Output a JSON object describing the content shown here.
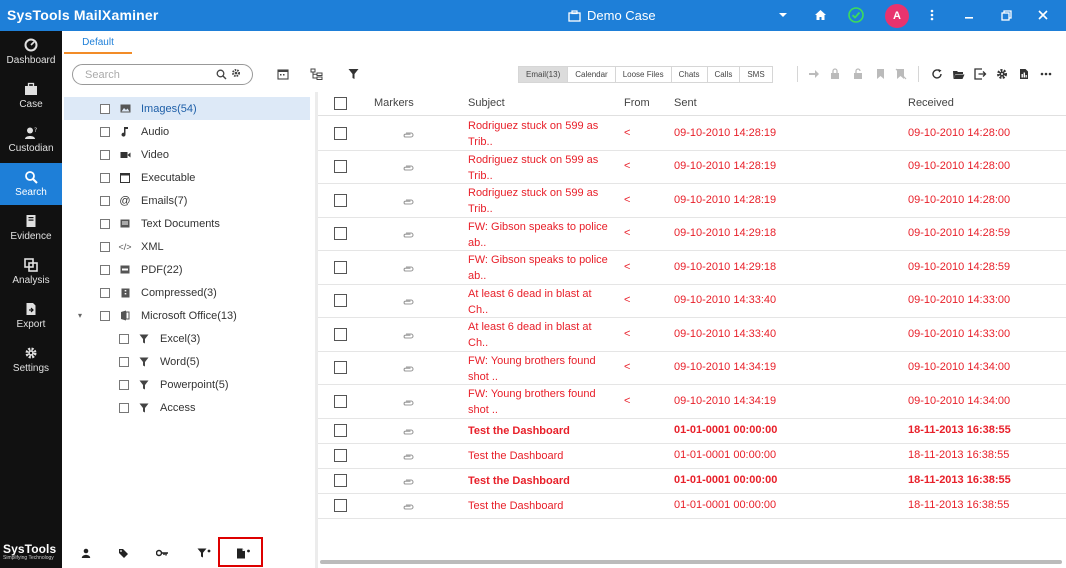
{
  "app": {
    "title": "SysTools MailXaminer",
    "case_title": "Demo Case",
    "avatar_initial": "A"
  },
  "nav": [
    {
      "label": "Dashboard",
      "icon": "dashboard-icon"
    },
    {
      "label": "Case",
      "icon": "briefcase-icon"
    },
    {
      "label": "Custodian",
      "icon": "custodian-icon"
    },
    {
      "label": "Search",
      "icon": "search-icon",
      "active": true
    },
    {
      "label": "Evidence",
      "icon": "evidence-icon"
    },
    {
      "label": "Analysis",
      "icon": "analysis-icon"
    },
    {
      "label": "Export",
      "icon": "export-icon"
    },
    {
      "label": "Settings",
      "icon": "gear-icon"
    }
  ],
  "brand": {
    "name": "SysTools",
    "tagline": "Simplifying Technology"
  },
  "tabs": {
    "default_label": "Default"
  },
  "search": {
    "placeholder": "Search",
    "value": ""
  },
  "category_tabs": [
    "Email(13)",
    "Calendar",
    "Loose Files",
    "Chats",
    "Calls",
    "SMS"
  ],
  "tree": [
    {
      "label": "Images(54)",
      "icon": "image-icon",
      "level": 0,
      "selected": true
    },
    {
      "label": "Audio",
      "icon": "music-icon",
      "level": 0
    },
    {
      "label": "Video",
      "icon": "video-icon",
      "level": 0
    },
    {
      "label": "Executable",
      "icon": "window-icon",
      "level": 0
    },
    {
      "label": "Emails(7)",
      "icon": "at-icon",
      "level": 0
    },
    {
      "label": "Text Documents",
      "icon": "text-doc-icon",
      "level": 0
    },
    {
      "label": "XML",
      "icon": "code-icon",
      "level": 0
    },
    {
      "label": "PDF(22)",
      "icon": "pdf-icon",
      "level": 0
    },
    {
      "label": "Compressed(3)",
      "icon": "archive-icon",
      "level": 0
    },
    {
      "label": "Microsoft Office(13)",
      "icon": "office-icon",
      "level": 0,
      "expanded": true
    },
    {
      "label": "Excel(3)",
      "icon": "filter-icon",
      "level": 1
    },
    {
      "label": "Word(5)",
      "icon": "filter-icon",
      "level": 1
    },
    {
      "label": "Powerpoint(5)",
      "icon": "filter-icon",
      "level": 1
    },
    {
      "label": "Access",
      "icon": "filter-icon",
      "level": 1
    }
  ],
  "table": {
    "headers": {
      "markers": "Markers",
      "subject": "Subject",
      "from": "From",
      "sent": "Sent",
      "received": "Received"
    },
    "rows": [
      {
        "subject": "Rodriguez stuck on 599 as Trib..",
        "from": "<",
        "sent": "09-10-2010 14:28:19",
        "received": "09-10-2010 14:28:00",
        "bold": false,
        "tall": true
      },
      {
        "subject": "Rodriguez stuck on 599 as Trib..",
        "from": "<",
        "sent": "09-10-2010 14:28:19",
        "received": "09-10-2010 14:28:00",
        "bold": false,
        "tall": true
      },
      {
        "subject": "Rodriguez stuck on 599 as Trib..",
        "from": "<",
        "sent": "09-10-2010 14:28:19",
        "received": "09-10-2010 14:28:00",
        "bold": false,
        "tall": true
      },
      {
        "subject": "FW: Gibson speaks to police ab..",
        "from": "<",
        "sent": "09-10-2010 14:29:18",
        "received": "09-10-2010 14:28:59",
        "bold": false,
        "tall": true
      },
      {
        "subject": "FW: Gibson speaks to police ab..",
        "from": "<",
        "sent": "09-10-2010 14:29:18",
        "received": "09-10-2010 14:28:59",
        "bold": false,
        "tall": true
      },
      {
        "subject": "At least 6 dead in blast at Ch..",
        "from": "<",
        "sent": "09-10-2010 14:33:40",
        "received": "09-10-2010 14:33:00",
        "bold": false,
        "tall": true
      },
      {
        "subject": "At least 6 dead in blast at Ch..",
        "from": "<",
        "sent": "09-10-2010 14:33:40",
        "received": "09-10-2010 14:33:00",
        "bold": false,
        "tall": true
      },
      {
        "subject": "FW: Young brothers found shot ..",
        "from": "<",
        "sent": "09-10-2010 14:34:19",
        "received": "09-10-2010 14:34:00",
        "bold": false,
        "tall": true
      },
      {
        "subject": "FW: Young brothers found shot ..",
        "from": "<",
        "sent": "09-10-2010 14:34:19",
        "received": "09-10-2010 14:34:00",
        "bold": false,
        "tall": true
      },
      {
        "subject": "Test the Dashboard",
        "from": "",
        "sent": "01-01-0001 00:00:00",
        "received": "18-11-2013 16:38:55",
        "bold": true,
        "tall": false
      },
      {
        "subject": "Test the Dashboard",
        "from": "",
        "sent": "01-01-0001 00:00:00",
        "received": "18-11-2013 16:38:55",
        "bold": false,
        "tall": false
      },
      {
        "subject": "Test the Dashboard",
        "from": "",
        "sent": "01-01-0001 00:00:00",
        "received": "18-11-2013 16:38:55",
        "bold": true,
        "tall": false
      },
      {
        "subject": "Test the Dashboard",
        "from": "",
        "sent": "01-01-0001 00:00:00",
        "received": "18-11-2013 16:38:55",
        "bold": false,
        "tall": false
      }
    ]
  },
  "colors": {
    "accent": "#1e7fd8",
    "row_text": "#e8202a",
    "tab_underline": "#f28c28",
    "nav_bg": "#111111",
    "avatar": "#e8336e",
    "highlight_box": "#dd0000"
  }
}
